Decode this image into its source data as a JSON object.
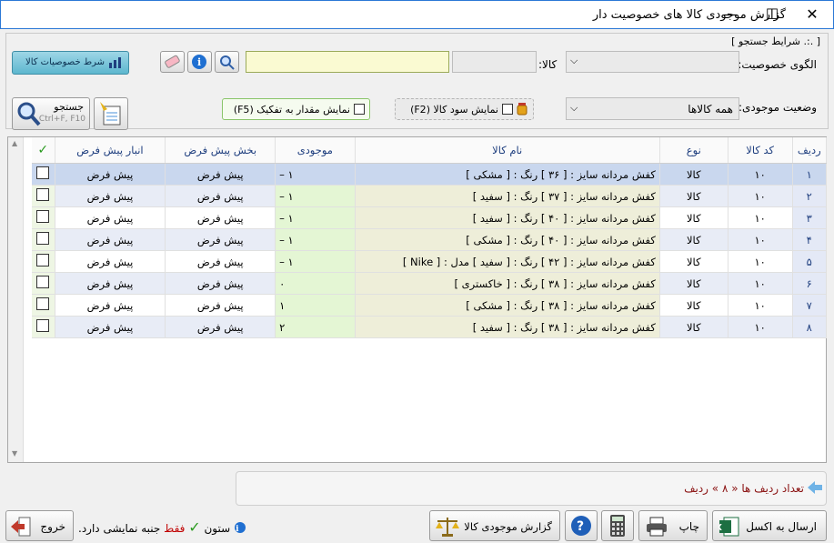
{
  "window": {
    "title": "گزارش موجودی کالا های خصوصیت دار",
    "minimize_label": "—",
    "maximize_label": "☐",
    "close_label": "✕"
  },
  "panel": {
    "search_conditions_label": "[ .:. شرایط جستجو ]",
    "pattern_label": "الگوی خصوصیت:",
    "pattern_value": "",
    "kala_label": "کالا:",
    "kala_code_value": "",
    "kala_name_value": "",
    "property_conditions_button": "شرط خصوصیات کالا",
    "stock_status_label": "وضعیت موجودی:",
    "stock_status_value": "همه کالاها",
    "show_profit_label": "نمایش سود کالا (F2)",
    "show_qty_separate_label": "نمایش مقدار به تفکیک (F5)",
    "search_button": "جستجو",
    "search_shortcut": "Ctrl+F, F10"
  },
  "grid": {
    "columns": [
      "ردیف",
      "کد کالا",
      "نوع",
      "نام کالا",
      "موجودی",
      "بخش پیش فرض",
      "انبار پیش فرض",
      "✓"
    ],
    "rows": [
      {
        "row": "۱",
        "code": "۱۰",
        "type": "کالا",
        "name": "کفش مردانه سایز : [ ۳۶ ] رنگ : [ مشکی ]",
        "qty": "۱ –",
        "section": "پیش فرض",
        "warehouse": "پیش فرض"
      },
      {
        "row": "۲",
        "code": "۱۰",
        "type": "کالا",
        "name": "کفش مردانه سایز : [ ۳۷ ] رنگ : [ سفید ]",
        "qty": "۱ –",
        "section": "پیش فرض",
        "warehouse": "پیش فرض"
      },
      {
        "row": "۳",
        "code": "۱۰",
        "type": "کالا",
        "name": "کفش مردانه سایز : [ ۴۰ ] رنگ : [ سفید ]",
        "qty": "۱ –",
        "section": "پیش فرض",
        "warehouse": "پیش فرض"
      },
      {
        "row": "۴",
        "code": "۱۰",
        "type": "کالا",
        "name": "کفش مردانه سایز : [ ۴۰ ] رنگ : [ مشکی ]",
        "qty": "۱ –",
        "section": "پیش فرض",
        "warehouse": "پیش فرض"
      },
      {
        "row": "۵",
        "code": "۱۰",
        "type": "کالا",
        "name": "کفش مردانه سایز : [ ۴۲ ] رنگ : [ سفید ] مدل : [ Nike ]",
        "qty": "۱ –",
        "section": "پیش فرض",
        "warehouse": "پیش فرض"
      },
      {
        "row": "۶",
        "code": "۱۰",
        "type": "کالا",
        "name": "کفش مردانه سایز : [ ۳۸ ] رنگ : [ خاکستری ]",
        "qty": "۰",
        "section": "پیش فرض",
        "warehouse": "پیش فرض"
      },
      {
        "row": "۷",
        "code": "۱۰",
        "type": "کالا",
        "name": "کفش مردانه سایز : [ ۳۸ ] رنگ : [ مشکی ]",
        "qty": "۱",
        "section": "پیش فرض",
        "warehouse": "پیش فرض"
      },
      {
        "row": "۸",
        "code": "۱۰",
        "type": "کالا",
        "name": "کفش مردانه سایز : [ ۳۸ ] رنگ : [ سفید ]",
        "qty": "۲",
        "section": "پیش فرض",
        "warehouse": "پیش فرض"
      }
    ]
  },
  "footer": {
    "row_count_text": "تعداد ردیف ها « ۸ » ردیف",
    "send_excel_button": "ارسال به اکسل",
    "print_button": "چاپ",
    "report_button": "گزارش موجودی کالا",
    "column_hint_prefix": "ستون",
    "column_hint_only": "فقط",
    "column_hint_suffix": "جنبه نمایشی دارد.",
    "exit_button": "خروج"
  },
  "colors": {
    "accent": "#1f3f7f",
    "selected_row": "#c9d7ee",
    "qty_cell": "#e4f6d4",
    "name_cell": "#eeeed9",
    "search_input": "#fafad2"
  }
}
